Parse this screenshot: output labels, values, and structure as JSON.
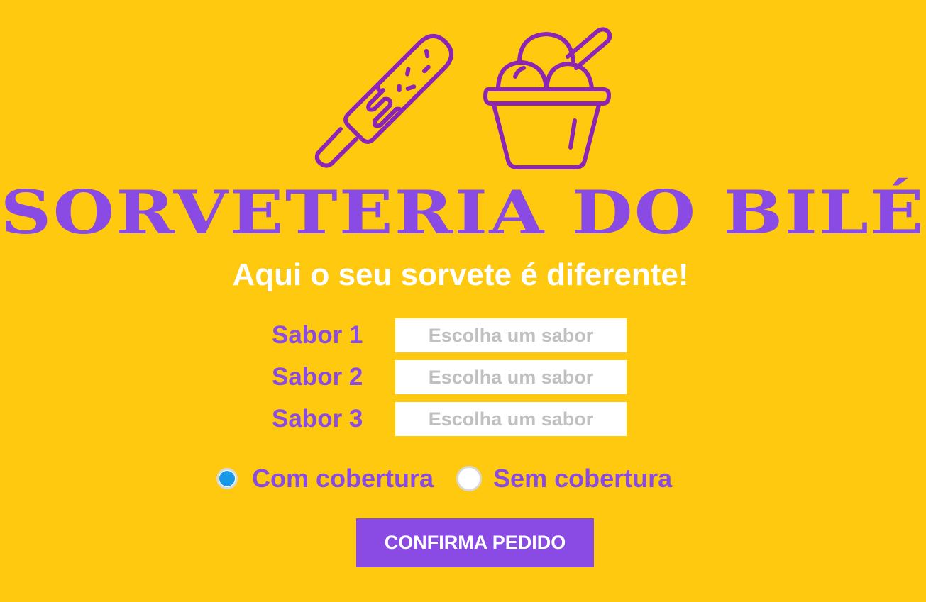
{
  "header": {
    "icons": [
      "popsicle-icon",
      "ice-cream-cup-icon"
    ],
    "title": "SORVETERIA DO BILÉ",
    "subtitle": "Aqui o seu sorvete é diferente!"
  },
  "form": {
    "flavors": [
      {
        "label": "Sabor 1",
        "placeholder": "Escolha um sabor",
        "value": ""
      },
      {
        "label": "Sabor 2",
        "placeholder": "Escolha um sabor",
        "value": ""
      },
      {
        "label": "Sabor 3",
        "placeholder": "Escolha um sabor",
        "value": ""
      }
    ],
    "topping": {
      "options": [
        {
          "label": "Com cobertura",
          "selected": true
        },
        {
          "label": "Sem cobertura",
          "selected": false
        }
      ]
    },
    "confirm_label": "CONFIRMA PEDIDO"
  },
  "colors": {
    "background": "#FEC90E",
    "accent": "#8A4BE5",
    "icon_stroke": "#8C24B8",
    "radio_selected": "#1899E6",
    "subtitle": "#FFFFFF"
  }
}
